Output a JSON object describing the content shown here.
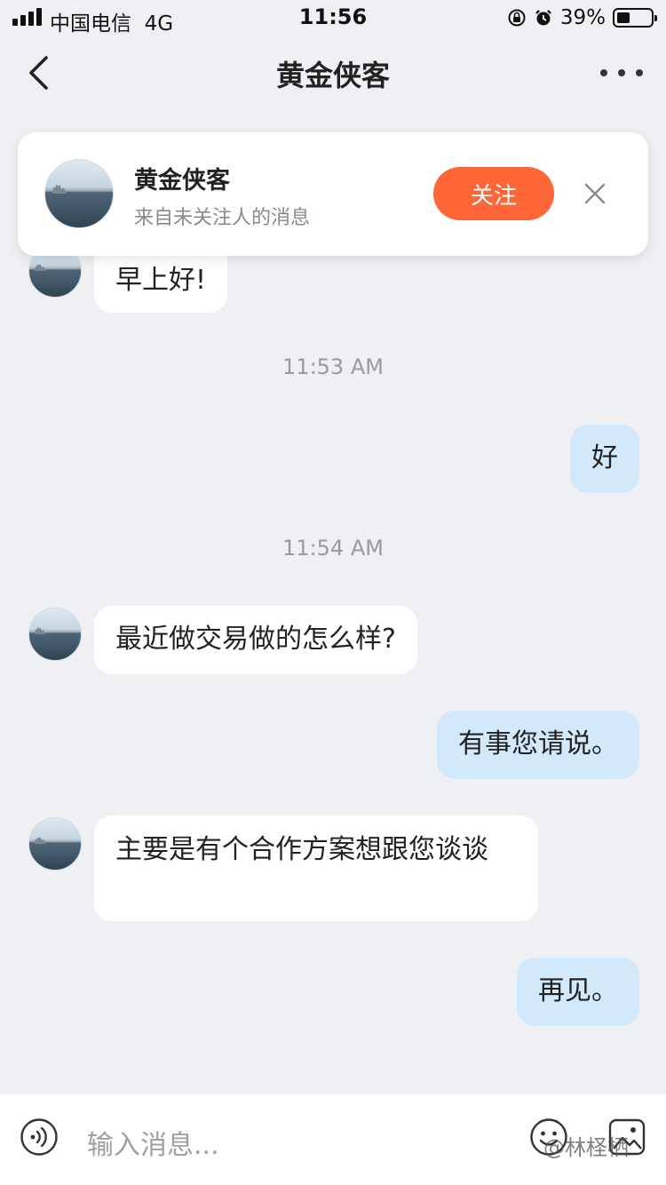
{
  "status_bar": {
    "carrier": "中国电信",
    "network": "4G",
    "time": "11:56",
    "battery_percent": "39%",
    "battery_level": 0.39
  },
  "nav": {
    "title": "黄金侠客"
  },
  "follow_card": {
    "name": "黄金侠客",
    "subtitle": "来自未关注人的消息",
    "follow_label": "关注",
    "accent_color": "#fe6638"
  },
  "messages": [
    {
      "type": "in",
      "text": "早上好!"
    },
    {
      "type": "time",
      "text": "11:53 AM"
    },
    {
      "type": "out",
      "text": "好"
    },
    {
      "type": "time",
      "text": "11:54 AM"
    },
    {
      "type": "in",
      "text": "最近做交易做的怎么样?"
    },
    {
      "type": "out",
      "text": "有事您请说。"
    },
    {
      "type": "in",
      "text": "主要是有个合作方案想跟您谈谈"
    },
    {
      "type": "out",
      "text": "再见。"
    }
  ],
  "input": {
    "placeholder": "输入消息...",
    "voice_icon": "voice-icon",
    "emoji_icon": "emoji-icon",
    "image_icon": "image-icon"
  },
  "watermark": "@林柽栖",
  "colors": {
    "outgoing_bubble": "#d2e8fb",
    "incoming_bubble": "#ffffff",
    "background": "#eff0f4"
  }
}
